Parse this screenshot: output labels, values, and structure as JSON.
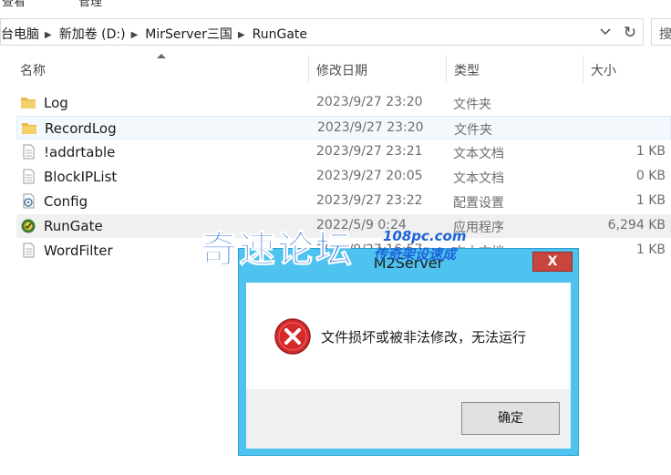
{
  "ribbon": {
    "tab_view": "查看",
    "tab_manage": "管理"
  },
  "address_bar": {
    "crumbs": [
      "台电脑",
      "新加卷 (D:)",
      "MirServer三国",
      "RunGate"
    ],
    "search_fragment": "搜"
  },
  "columns": {
    "name": "名称",
    "date": "修改日期",
    "type": "类型",
    "size": "大小"
  },
  "files": [
    {
      "name": "Log",
      "date": "2023/9/27 23:20",
      "type": "文件夹",
      "size": "",
      "icon": "folder-icon"
    },
    {
      "name": "RecordLog",
      "date": "2023/9/27 23:20",
      "type": "文件夹",
      "size": "",
      "icon": "folder-icon"
    },
    {
      "name": "!addrtable",
      "date": "2023/9/27 23:21",
      "type": "文本文档",
      "size": "1 KB",
      "icon": "text-file-icon"
    },
    {
      "name": "BlockIPList",
      "date": "2023/9/27 20:05",
      "type": "文本文档",
      "size": "0 KB",
      "icon": "text-file-icon"
    },
    {
      "name": "Config",
      "date": "2023/9/27 23:22",
      "type": "配置设置",
      "size": "1 KB",
      "icon": "config-file-icon"
    },
    {
      "name": "RunGate",
      "date": "2022/5/9 0:24",
      "type": "应用程序",
      "size": "6,294 KB",
      "icon": "application-icon"
    },
    {
      "name": "WordFilter",
      "date": "2023/9/27 16:57",
      "type": "文本文档",
      "size": "1 KB",
      "icon": "text-file-icon"
    }
  ],
  "dialog": {
    "title": "M2Server",
    "close_label": "X",
    "message": "文件损坏或被非法修改，无法运行",
    "ok_label": "确定"
  },
  "watermark": {
    "site": "奇速论坛",
    "url": "108pc.com",
    "tagline": "传奇架设速成"
  },
  "colors": {
    "dialog_frame": "#4fc3ef",
    "close_button": "#c7463d",
    "error_icon": "#d42a2a",
    "watermark": "#1d63d8",
    "selection": "#f3f8fd"
  }
}
